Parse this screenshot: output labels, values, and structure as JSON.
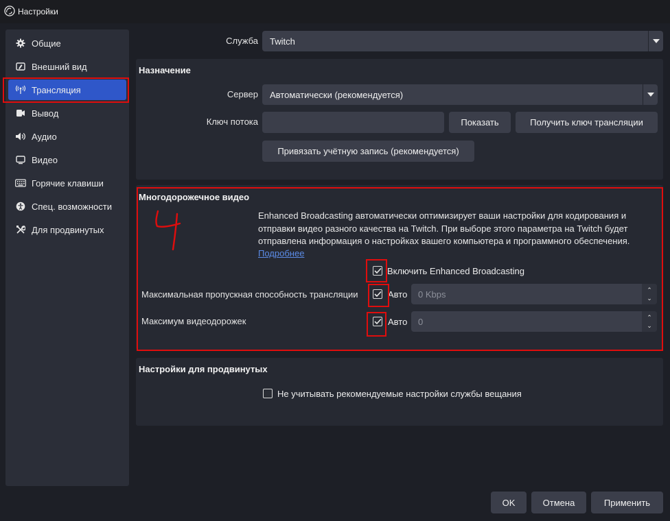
{
  "window": {
    "title": "Настройки"
  },
  "sidebar": {
    "items": [
      {
        "label": "Общие",
        "icon": "gear-icon"
      },
      {
        "label": "Внешний вид",
        "icon": "appearance-icon"
      },
      {
        "label": "Трансляция",
        "icon": "broadcast-icon",
        "active": true
      },
      {
        "label": "Вывод",
        "icon": "output-icon"
      },
      {
        "label": "Аудио",
        "icon": "speaker-icon"
      },
      {
        "label": "Видео",
        "icon": "monitor-icon"
      },
      {
        "label": "Горячие клавиши",
        "icon": "keyboard-icon"
      },
      {
        "label": "Спец. возможности",
        "icon": "accessibility-icon"
      },
      {
        "label": "Для продвинутых",
        "icon": "tools-icon"
      }
    ]
  },
  "service": {
    "label": "Служба",
    "value": "Twitch"
  },
  "destination": {
    "title": "Назначение",
    "server_label": "Сервер",
    "server_value": "Автоматически (рекомендуется)",
    "stream_key_label": "Ключ потока",
    "stream_key_value": "",
    "show_button": "Показать",
    "get_key_button": "Получить ключ трансляции",
    "connect_account_button": "Привязать учётную запись (рекомендуется)"
  },
  "multitrack": {
    "title": "Многодорожечное видео",
    "description": "Enhanced Broadcasting автоматически оптимизирует ваши настройки для кодирования и отправки видео разного качества на Twitch. При выборе этого параметра на Twitch будет отправлена информация о настройках вашего компьютера и программного обеспечения.",
    "more_link": "Подробнее",
    "enable_label": "Включить Enhanced Broadcasting",
    "enable_checked": true,
    "max_bandwidth_label": "Максимальная пропускная способность трансляции",
    "max_bandwidth_auto_label": "Авто",
    "max_bandwidth_auto_checked": true,
    "max_bandwidth_value": "0 Kbps",
    "max_tracks_label": "Максимум видеодорожек",
    "max_tracks_auto_label": "Авто",
    "max_tracks_auto_checked": true,
    "max_tracks_value": "0",
    "annotation_mark": "4"
  },
  "advanced": {
    "title": "Настройки для продвинутых",
    "ignore_label": "Не учитывать рекомендуемые настройки службы вещания",
    "ignore_checked": false
  },
  "footer": {
    "ok": "OK",
    "cancel": "Отмена",
    "apply": "Применить"
  },
  "colors": {
    "accent": "#2f57c9",
    "highlight": "#e00d0d",
    "link": "#5b8be6",
    "background": "#1d1f26",
    "panel": "#262932"
  }
}
